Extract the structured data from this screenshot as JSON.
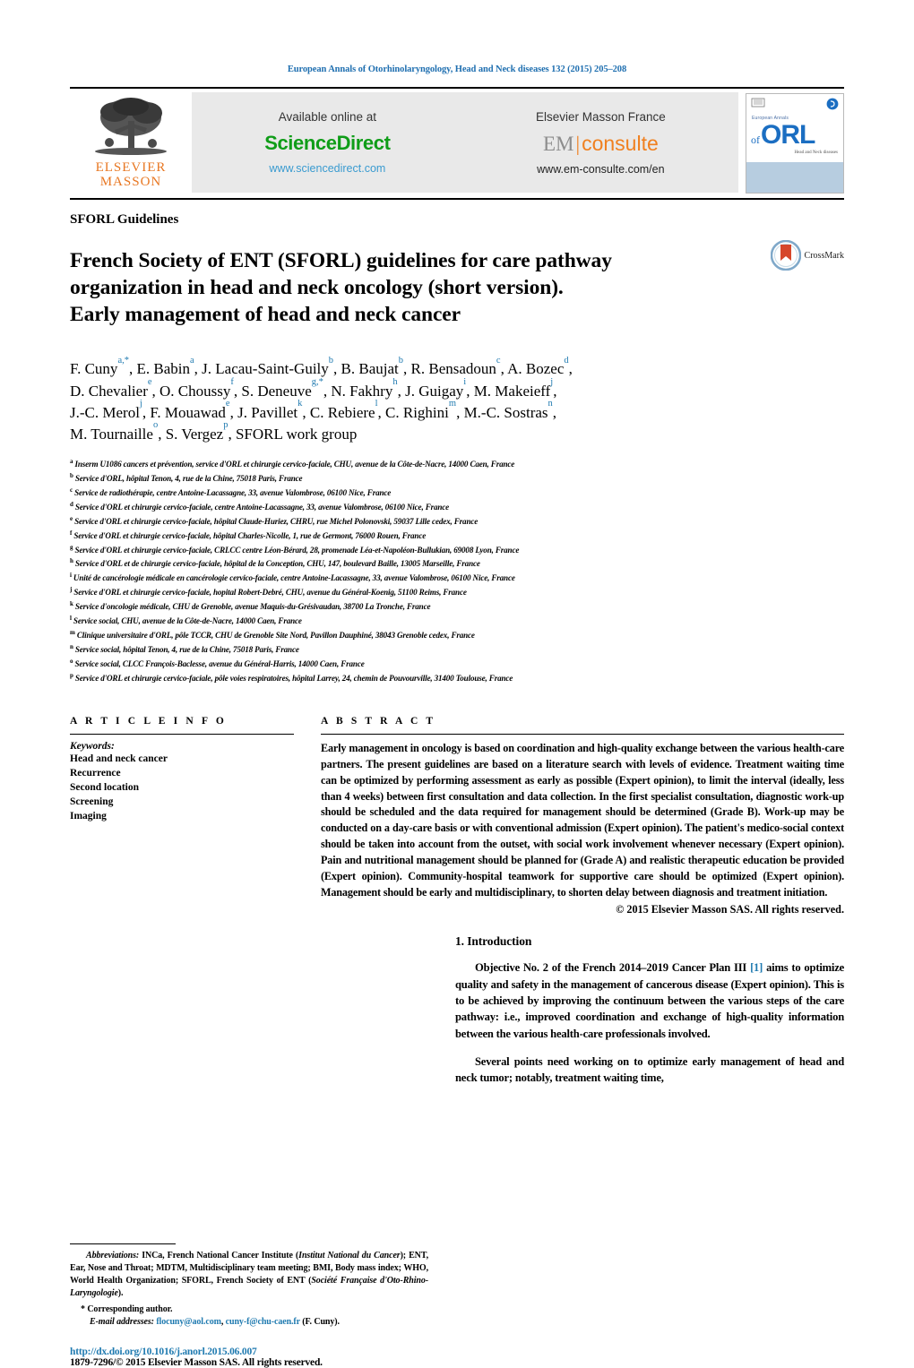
{
  "running_head": "European Annals of Otorhinolaryngology, Head and Neck diseases 132 (2015) 205–208",
  "masthead": {
    "elsevier_line1": "ELSEVIER",
    "elsevier_line2": "MASSON",
    "sciencedirect": {
      "available_text": "Available online at",
      "brand": "ScienceDirect",
      "url": "www.sciencedirect.com"
    },
    "emconsulte": {
      "publisher_text": "Elsevier Masson France",
      "brand_prefix": "EM",
      "brand_suffix": "consulte",
      "url": "www.em-consulte.com/en"
    },
    "journal_cover": {
      "eyebrow": "European Annals",
      "of": "of",
      "letters": "ORL",
      "sub": "Head and Neck diseases"
    }
  },
  "article": {
    "section_label": "SFORL Guidelines",
    "title_line1": "French Society of ENT (SFORL) guidelines for care pathway",
    "title_line2": "organization in head and neck oncology (short version).",
    "title_line3": "Early management of head and neck cancer",
    "crossmark_label": "CrossMark"
  },
  "authors": [
    {
      "name": "F. Cuny",
      "sup": "a,*"
    },
    {
      "name": "E. Babin",
      "sup": "a"
    },
    {
      "name": "J. Lacau-Saint-Guily",
      "sup": "b"
    },
    {
      "name": "B. Baujat",
      "sup": "b"
    },
    {
      "name": "R. Bensadoun",
      "sup": "c"
    },
    {
      "name": "A. Bozec",
      "sup": "d"
    },
    {
      "name": "D. Chevalier",
      "sup": "e"
    },
    {
      "name": "O. Choussy",
      "sup": "f"
    },
    {
      "name": "S. Deneuve",
      "sup": "g,*"
    },
    {
      "name": "N. Fakhry",
      "sup": "h"
    },
    {
      "name": "J. Guigay",
      "sup": "i"
    },
    {
      "name": "M. Makeieff",
      "sup": "j"
    },
    {
      "name": "J.-C. Merol",
      "sup": "j"
    },
    {
      "name": "F. Mouawad",
      "sup": "e"
    },
    {
      "name": "J. Pavillet",
      "sup": "k"
    },
    {
      "name": "C. Rebiere",
      "sup": "l"
    },
    {
      "name": "C. Righini",
      "sup": "m"
    },
    {
      "name": "M.-C. Sostras",
      "sup": "n"
    },
    {
      "name": "M. Tournaille",
      "sup": "o"
    },
    {
      "name": "S. Vergez",
      "sup": "p"
    },
    {
      "name": "SFORL work group",
      "sup": ""
    }
  ],
  "affiliations": [
    {
      "sup": "a",
      "text": "Inserm U1086 cancers et prévention, service d'ORL et chirurgie cervico-faciale, CHU, avenue de la Côte-de-Nacre, 14000 Caen, France"
    },
    {
      "sup": "b",
      "text": "Service d'ORL, hôpital Tenon, 4, rue de la Chine, 75018 Paris, France"
    },
    {
      "sup": "c",
      "text": "Service de radiothérapie, centre Antoine-Lacassagne, 33, avenue Valombrose, 06100 Nice, France"
    },
    {
      "sup": "d",
      "text": "Service d'ORL et chirurgie cervico-faciale, centre Antoine-Lacassagne, 33, avenue Valombrose, 06100 Nice, France"
    },
    {
      "sup": "e",
      "text": "Service d'ORL et chirurgie cervico-faciale, hôpital Claude-Huriez, CHRU, rue Michel Polonovski, 59037 Lille cedex, France"
    },
    {
      "sup": "f",
      "text": "Service d'ORL et chirurgie cervico-faciale, hôpital Charles-Nicolle, 1, rue de Germont, 76000 Rouen, France"
    },
    {
      "sup": "g",
      "text": "Service d'ORL et chirurgie cervico-faciale, CRLCC centre Léon-Bérard, 28, promenade Léa-et-Napoléon-Bullukian, 69008 Lyon, France"
    },
    {
      "sup": "h",
      "text": "Service d'ORL et de chirurgie cervico-faciale, hôpital de la Conception, CHU, 147, boulevard Baille, 13005 Marseille, France"
    },
    {
      "sup": "i",
      "text": "Unité de cancérologie médicale en cancérologie cervico-faciale, centre Antoine-Lacassagne, 33, avenue Valombrose, 06100 Nice, France"
    },
    {
      "sup": "j",
      "text": "Service d'ORL et chirurgie cervico-faciale, hopital Robert-Debré, CHU, avenue du Général-Koenig, 51100 Reims, France"
    },
    {
      "sup": "k",
      "text": "Service d'oncologie médicale, CHU de Grenoble, avenue Maquis-du-Grésivaudan, 38700 La Tronche, France"
    },
    {
      "sup": "l",
      "text": "Service social, CHU, avenue de la Côte-de-Nacre, 14000 Caen, France"
    },
    {
      "sup": "m",
      "text": "Clinique universitaire d'ORL, pôle TCCR, CHU de Grenoble Site Nord, Pavillon Dauphiné, 38043 Grenoble cedex, France"
    },
    {
      "sup": "n",
      "text": "Service social, hôpital Tenon, 4, rue de la Chine, 75018 Paris, France"
    },
    {
      "sup": "o",
      "text": "Service social, CLCC François-Baclesse, avenue du Général-Harris, 14000 Caen, France"
    },
    {
      "sup": "p",
      "text": "Service d'ORL et chirurgie cervico-faciale, pôle voies respiratoires, hôpital Larrey, 24, chemin de Pouvourville, 31400 Toulouse, France"
    }
  ],
  "article_info": {
    "heading": "A R T I C L E   I N F O",
    "keywords_label": "Keywords:",
    "keywords": [
      "Head and neck cancer",
      "Recurrence",
      "Second location",
      "Screening",
      "Imaging"
    ]
  },
  "abstract": {
    "heading": "A B S T R A C T",
    "text": "Early management in oncology is based on coordination and high-quality exchange between the various health-care partners. The present guidelines are based on a literature search with levels of evidence. Treatment waiting time can be optimized by performing assessment as early as possible (Expert opinion), to limit the interval (ideally, less than 4 weeks) between first consultation and data collection. In the first specialist consultation, diagnostic work-up should be scheduled and the data required for management should be determined (Grade B). Work-up may be conducted on a day-care basis or with conventional admission (Expert opinion). The patient's medico-social context should be taken into account from the outset, with social work involvement whenever necessary (Expert opinion). Pain and nutritional management should be planned for (Grade A) and realistic therapeutic education be provided (Expert opinion). Community-hospital teamwork for supportive care should be optimized (Expert opinion). Management should be early and multidisciplinary, to shorten delay between diagnosis and treatment initiation.",
    "copyright": "© 2015 Elsevier Masson SAS. All rights reserved."
  },
  "introduction": {
    "heading": "1. Introduction",
    "para1_before": "Objective No. 2 of the French 2014–2019 Cancer Plan III ",
    "para1_ref": "[1]",
    "para1_after": " aims to optimize quality and safety in the management of cancerous disease (Expert opinion). This is to be achieved by improving the continuum between the various steps of the care pathway: i.e., improved coordination and exchange of high-quality information between the various health-care professionals involved.",
    "para2": "Several points need working on to optimize early management of head and neck tumor; notably, treatment waiting time,"
  },
  "footnotes": {
    "abbrev_label": "Abbreviations:",
    "abbrev_text_1": " INCa, French National Cancer Institute (",
    "abbrev_italic_1": "Institut National du Cancer",
    "abbrev_text_2": "); ENT, Ear, Nose and Throat; MDTM, Multidisciplinary team meeting; BMI, Body mass index; WHO, World Health Organization; SFORL, French Society of ENT (",
    "abbrev_italic_2": "Société Française d'Oto-Rhino-Laryngologie",
    "abbrev_text_3": ").",
    "corresponding_marker": "*",
    "corresponding_label": "Corresponding author.",
    "email_label": "E-mail addresses:",
    "email_1": "flocuny@aol.com",
    "email_sep": ", ",
    "email_2": "cuny-f@chu-caen.fr",
    "email_suffix": " (F. Cuny).",
    "doi": "http://dx.doi.org/10.1016/j.anorl.2015.06.007",
    "issn_line": "1879-7296/© 2015 Elsevier Masson SAS. All rights reserved."
  },
  "colors": {
    "link_blue": "#1f7ab0",
    "sciencedirect_green": "#0f9d18",
    "elsevier_orange": "#e87722",
    "emconsulte_orange": "#f08020",
    "orl_blue": "#1b6ec2"
  }
}
